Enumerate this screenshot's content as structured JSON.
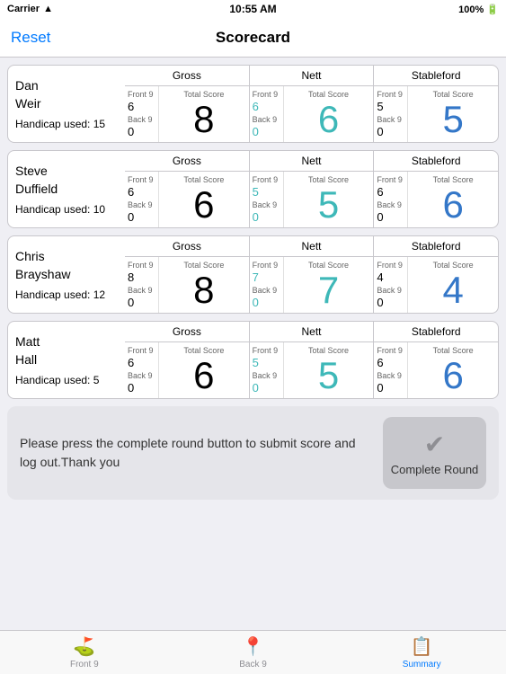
{
  "status_bar": {
    "carrier": "Carrier",
    "time": "10:55 AM",
    "battery": "100%",
    "wifi": "WiFi"
  },
  "nav": {
    "title": "Scorecard",
    "reset_label": "Reset"
  },
  "sections": {
    "gross": "Gross",
    "nett": "Nett",
    "stableford": "Stableford",
    "front9": "Front 9",
    "back9": "Back 9",
    "total_score": "Total Score"
  },
  "players": [
    {
      "name_line1": "Dan",
      "name_line2": "Weir",
      "handicap": "Handicap used: 15",
      "gross": {
        "front9": "6",
        "back9": "0",
        "total": "8"
      },
      "nett": {
        "front9": "6",
        "back9": "0",
        "total": "6"
      },
      "stableford": {
        "front9": "5",
        "back9": "0",
        "total": "5"
      }
    },
    {
      "name_line1": "Steve",
      "name_line2": "Duffield",
      "handicap": "Handicap used: 10",
      "gross": {
        "front9": "6",
        "back9": "0",
        "total": "6"
      },
      "nett": {
        "front9": "5",
        "back9": "0",
        "total": "5"
      },
      "stableford": {
        "front9": "6",
        "back9": "0",
        "total": "6"
      }
    },
    {
      "name_line1": "Chris",
      "name_line2": "Brayshaw",
      "handicap": "Handicap used: 12",
      "gross": {
        "front9": "8",
        "back9": "0",
        "total": "8"
      },
      "nett": {
        "front9": "7",
        "back9": "0",
        "total": "7"
      },
      "stableford": {
        "front9": "4",
        "back9": "0",
        "total": "4"
      }
    },
    {
      "name_line1": "Matt",
      "name_line2": "Hall",
      "handicap": "Handicap used: 5",
      "gross": {
        "front9": "6",
        "back9": "0",
        "total": "6"
      },
      "nett": {
        "front9": "5",
        "back9": "0",
        "total": "5"
      },
      "stableford": {
        "front9": "6",
        "back9": "0",
        "total": "6"
      }
    }
  ],
  "bottom": {
    "message": "Please press the complete round button to submit score and log out.Thank you",
    "button_label": "Complete Round"
  },
  "tabs": [
    {
      "id": "front9",
      "label": "Front 9",
      "icon": "⛳",
      "active": false
    },
    {
      "id": "back9",
      "label": "Back 9",
      "icon": "📍",
      "active": false
    },
    {
      "id": "summary",
      "label": "Summary",
      "icon": "📋",
      "active": true
    }
  ]
}
